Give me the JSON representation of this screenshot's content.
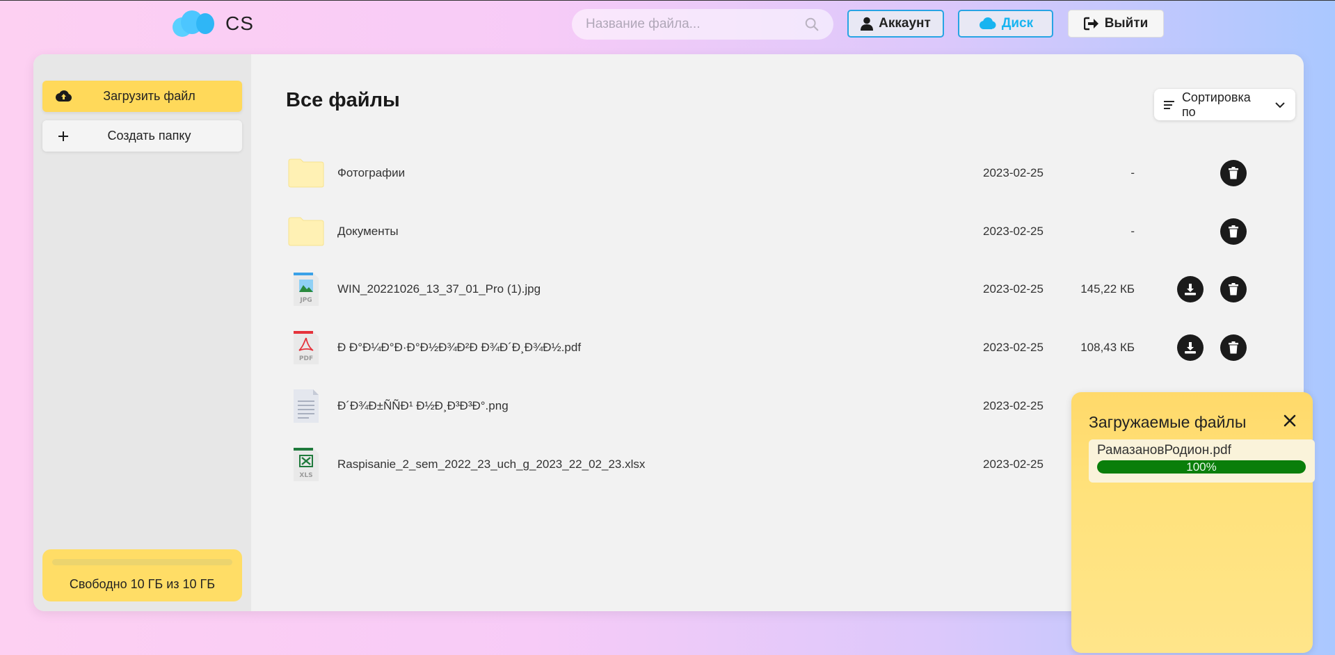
{
  "header": {
    "logo_text": "CS",
    "search": {
      "placeholder": "Название файла..."
    },
    "account_label": "Аккаунт",
    "disk_label": "Диск",
    "logout_label": "Выйти"
  },
  "sidebar": {
    "upload_label": "Загрузить файл",
    "create_folder_label": "Создать папку",
    "storage": {
      "text": "Свободно 10 ГБ из 10 ГБ",
      "used_fraction": 0.0
    }
  },
  "main": {
    "title": "Все файлы",
    "sort_label": "Сортировка по",
    "files": [
      {
        "type": "folder",
        "name": "Фотографии",
        "date": "2023-02-25",
        "size": "-",
        "downloadable": false
      },
      {
        "type": "folder",
        "name": "Документы",
        "date": "2023-02-25",
        "size": "-",
        "downloadable": false
      },
      {
        "type": "jpg",
        "name": "WIN_20221026_13_37_01_Pro (1).jpg",
        "date": "2023-02-25",
        "size": "145,22 КБ",
        "downloadable": true
      },
      {
        "type": "pdf",
        "name": "Ð Ð°Ð¼Ð°Ð·Ð°Ð½Ð¾Ð²Ð Ð¾Ð´Ð¸Ð¾Ð½.pdf",
        "date": "2023-02-25",
        "size": "108,43 КБ",
        "downloadable": true
      },
      {
        "type": "png",
        "name": "Ð´Ð¾Ð±ÑÑÐ¹ Ð½Ð¸Ð³Ð³Ð°.png",
        "date": "2023-02-25",
        "size": "",
        "downloadable": false
      },
      {
        "type": "xls",
        "name": "Raspisanie_2_sem_2022_23_uch_g_2023_22_02_23.xlsx",
        "date": "2023-02-25",
        "size": "",
        "downloadable": false
      }
    ]
  },
  "uploads": {
    "title": "Загружаемые файлы",
    "items": [
      {
        "name": "РамазановРодион.pdf",
        "progress_text": "100%",
        "progress": 1.0
      }
    ]
  },
  "colors": {
    "accent": "#27a4e4",
    "upload_button": "#ffd95a",
    "progress": "#0a7e0a",
    "action_button": "#1b1b1b"
  }
}
